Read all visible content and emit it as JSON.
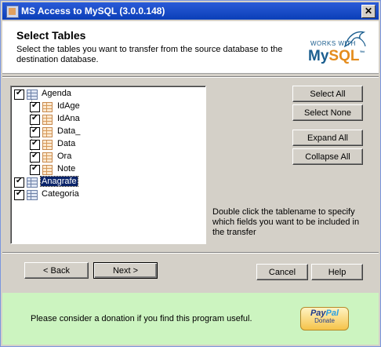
{
  "window": {
    "title": "MS Access to MySQL (3.0.0.148)",
    "close_glyph": "✕"
  },
  "header": {
    "heading": "Select Tables",
    "description": "Select the tables you want to transfer from the source database to the destination database.",
    "logo": {
      "works_with": "WORKS WITH",
      "brand_my": "My",
      "brand_sql": "SQL",
      "brand_tm": "™"
    }
  },
  "tree": {
    "tables": [
      {
        "label": "Agenda",
        "checked": true,
        "fields": [
          "IdAge",
          "IdAna",
          "Data_",
          "Data",
          "Ora",
          "Note"
        ]
      },
      {
        "label": "Anagrafe",
        "checked": true,
        "selected": true
      },
      {
        "label": "Categoria",
        "checked": true
      }
    ]
  },
  "side_buttons": {
    "select_all": "Select All",
    "select_none": "Select None",
    "expand_all": "Expand All",
    "collapse_all": "Collapse All"
  },
  "hint": "Double click the tablename to specify which fields you want to be included in the transfer",
  "nav": {
    "back": "< Back",
    "next": "Next >",
    "cancel": "Cancel",
    "help": "Help"
  },
  "donate": {
    "message": "Please consider a donation if you find this program useful.",
    "paypal_pay": "Pay",
    "paypal_pal": "Pal",
    "paypal_label": "Donate"
  }
}
